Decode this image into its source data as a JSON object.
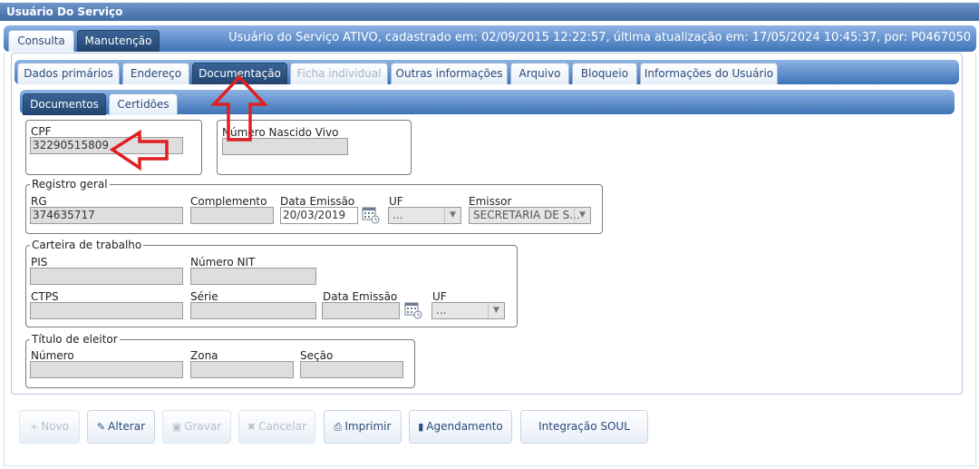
{
  "window": {
    "title": "Usuário Do Serviço"
  },
  "top_tabs": [
    {
      "label": "Consulta",
      "active": false
    },
    {
      "label": "Manutenção",
      "active": true
    }
  ],
  "status": "Usuário do Serviço ATIVO, cadastrado em: 02/09/2015 12:22:57, última atualização em: 17/05/2024 10:45:37, por: P0467050",
  "section_tabs": [
    {
      "label": "Dados primários",
      "state": "normal"
    },
    {
      "label": "Endereço",
      "state": "normal"
    },
    {
      "label": "Documentação",
      "state": "active"
    },
    {
      "label": "Ficha individual",
      "state": "disabled"
    },
    {
      "label": "Outras informações",
      "state": "normal"
    },
    {
      "label": "Arquivo",
      "state": "normal"
    },
    {
      "label": "Bloqueio",
      "state": "normal"
    },
    {
      "label": "Informações do Usuário",
      "state": "normal"
    }
  ],
  "doc_tabs": [
    {
      "label": "Documentos",
      "active": true
    },
    {
      "label": "Certidões",
      "active": false
    }
  ],
  "cpf": {
    "label": "CPF",
    "value": "32290515809"
  },
  "nascido_vivo": {
    "label": "Número Nascido Vivo",
    "value": ""
  },
  "registro_geral": {
    "legend": "Registro geral",
    "rg_label": "RG",
    "rg_value": "374635717",
    "complemento_label": "Complemento",
    "complemento_value": "",
    "data_emissao_label": "Data Emissão",
    "data_emissao_value": "20/03/2019",
    "uf_label": "UF",
    "uf_value": "...",
    "emissor_label": "Emissor",
    "emissor_value": "SECRETARIA DE S..."
  },
  "carteira_trabalho": {
    "legend": "Carteira de trabalho",
    "pis_label": "PIS",
    "pis_value": "",
    "nit_label": "Número NIT",
    "nit_value": "",
    "ctps_label": "CTPS",
    "ctps_value": "",
    "serie_label": "Série",
    "serie_value": "",
    "data_emissao_label": "Data Emissão",
    "data_emissao_value": "",
    "uf_label": "UF",
    "uf_value": "..."
  },
  "titulo_eleitor": {
    "legend": "Título de eleitor",
    "numero_label": "Número",
    "numero_value": "",
    "zona_label": "Zona",
    "zona_value": "",
    "secao_label": "Seção",
    "secao_value": ""
  },
  "buttons": {
    "novo": "Novo",
    "alterar": "Alterar",
    "gravar": "Gravar",
    "cancelar": "Cancelar",
    "imprimir": "Imprimir",
    "agendamento": "Agendamento",
    "integracao": "Integração SOUL"
  },
  "colors": {
    "tabbar_blue": "#3d73b8",
    "active_tab": "#22456f",
    "annotation_red": "#e02020"
  }
}
